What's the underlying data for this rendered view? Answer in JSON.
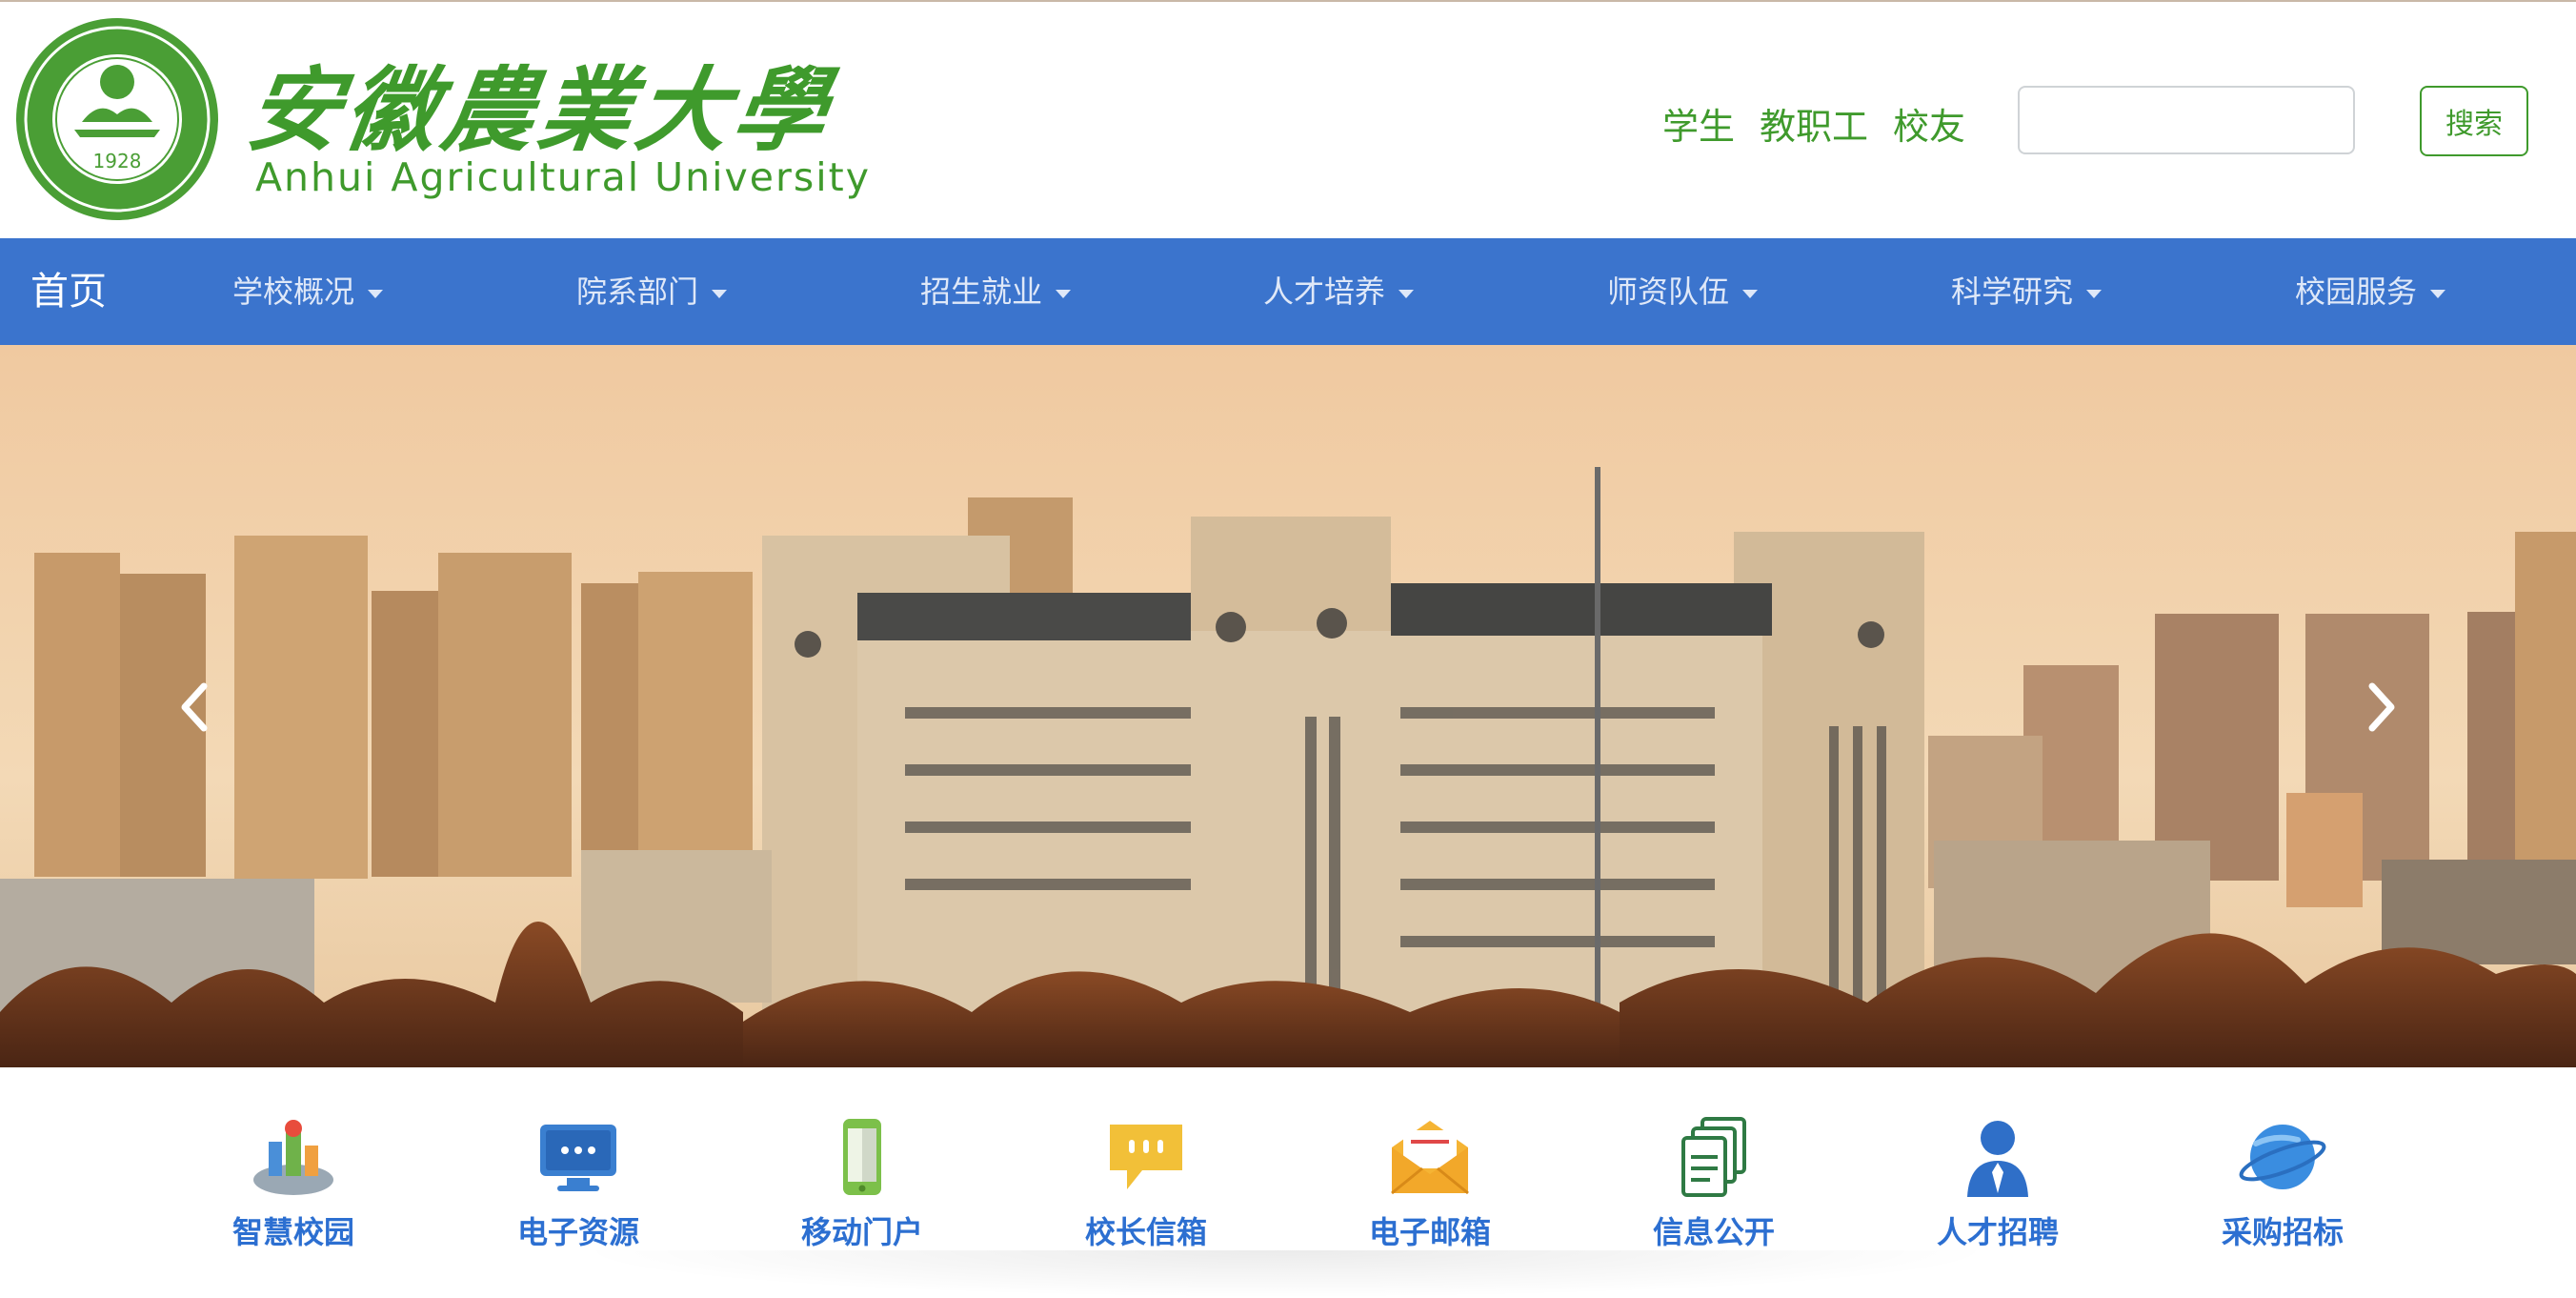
{
  "header": {
    "logo_text_cn": "安徽農業大學",
    "logo_text_en": "Anhui Agricultural University",
    "seal_year": "1928",
    "quick_links": [
      "学生",
      "教职工",
      "校友"
    ],
    "search": {
      "placeholder": "",
      "button_label": "搜索"
    }
  },
  "nav": {
    "home": "首页",
    "items": [
      "学校概况",
      "院系部门",
      "招生就业",
      "人才培养",
      "师资队伍",
      "科学研究",
      "校园服务"
    ]
  },
  "banner": {
    "prev_icon": "chevron-left-icon",
    "next_icon": "chevron-right-icon"
  },
  "services": [
    {
      "label": "智慧校园",
      "icon": "smart-campus-icon"
    },
    {
      "label": "电子资源",
      "icon": "monitor-icon"
    },
    {
      "label": "移动门户",
      "icon": "mobile-phone-icon"
    },
    {
      "label": "校长信箱",
      "icon": "chat-bubble-icon"
    },
    {
      "label": "电子邮箱",
      "icon": "envelope-icon"
    },
    {
      "label": "信息公开",
      "icon": "documents-icon"
    },
    {
      "label": "人才招聘",
      "icon": "person-icon"
    },
    {
      "label": "采购招标",
      "icon": "planet-icon"
    }
  ],
  "colors": {
    "brand_green": "#3f9a2c",
    "nav_blue": "#3b74cd",
    "service_blue": "#2c6fd1"
  }
}
